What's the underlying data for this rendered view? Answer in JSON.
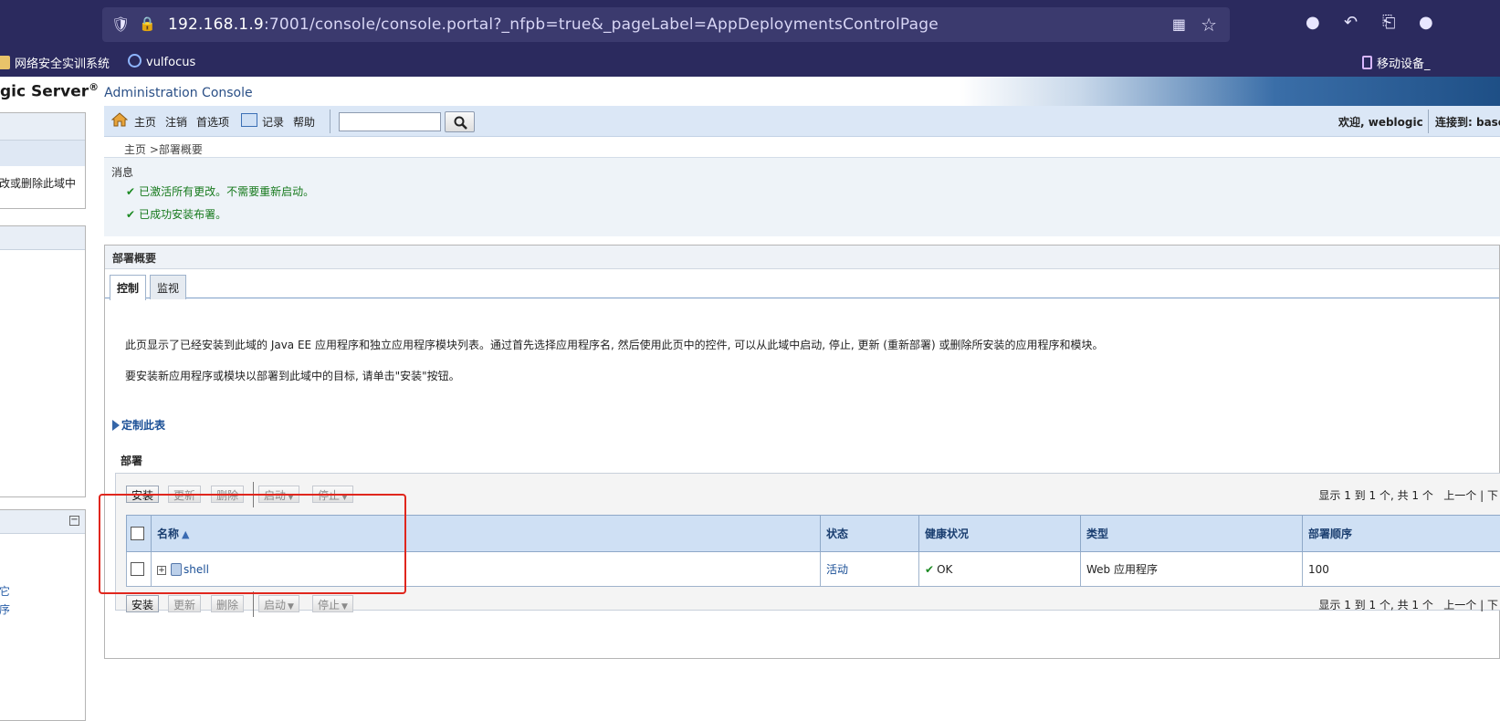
{
  "browser": {
    "url_host": "192.168.1.9",
    "url_rest": ":7001/console/console.portal?_nfpb=true&_pageLabel=AppDeploymentsControlPage",
    "bookmarks": [
      "网络安全实训系统",
      "vulfocus"
    ],
    "mobile_bookmark": "移动设备_"
  },
  "header": {
    "title": "gic Server",
    "reg": "®",
    "subtitle": "Administration Console"
  },
  "left_panel": {
    "item_text": "改或删除此域中",
    "link1": "它",
    "link2": "序"
  },
  "toolbar": {
    "home": "主页",
    "logout": "注销",
    "preferences": "首选项",
    "record": "记录",
    "help": "帮助",
    "search_value": "",
    "welcome": "欢迎, weblogic",
    "connected": "连接到: base"
  },
  "breadcrumb": "主页 >部署概要",
  "messages": {
    "title": "消息",
    "items": [
      "已激活所有更改。不需要重新启动。",
      "已成功安装布署。"
    ]
  },
  "main": {
    "title": "部署概要",
    "tabs": [
      "控制",
      "监视"
    ],
    "desc1": "此页显示了已经安装到此域的 Java EE 应用程序和独立应用程序模块列表。通过首先选择应用程序名, 然后使用此页中的控件, 可以从此域中启动, 停止, 更新 (重新部署) 或删除所安装的应用程序和模块。",
    "desc2": "要安装新应用程序或模块以部署到此域中的目标, 请单击\"安装\"按钮。",
    "customize": "定制此表",
    "section": "部署"
  },
  "buttons": {
    "install": "安装",
    "update": "更新",
    "delete": "删除",
    "start": "启动",
    "stop": "停止"
  },
  "pager": {
    "text": "显示 1 到 1 个, 共 1 个",
    "prev": "上一个",
    "next": "下"
  },
  "table": {
    "columns": [
      "名称",
      "状态",
      "健康状况",
      "类型",
      "部署顺序"
    ],
    "rows": [
      {
        "name": "shell",
        "state": "活动",
        "health": "OK",
        "type": "Web 应用程序",
        "order": "100"
      }
    ]
  },
  "colors": {
    "browser_bg": "#2b2a5e",
    "toolbar_bg": "#dbe7f6",
    "header_cell": "#cfe0f4",
    "link": "#1a4f96",
    "success": "#177a1d",
    "highlight": "#e0261d"
  }
}
